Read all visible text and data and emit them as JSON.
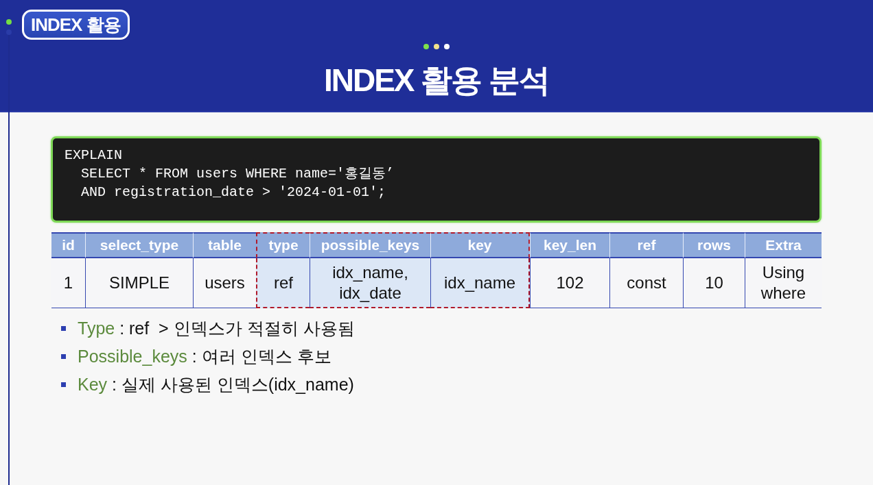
{
  "header": {
    "badge": "INDEX 활용",
    "dots": [
      {
        "color": "#7ee04b"
      },
      {
        "color": "#f2e38c"
      },
      {
        "color": "#ffffff"
      }
    ],
    "title": "INDEX 활용 분석"
  },
  "code": {
    "lines": [
      "EXPLAIN",
      "  SELECT * FROM users WHERE name='홍길동’",
      "  AND registration_date > '2024-01-01';"
    ]
  },
  "table": {
    "columns": [
      {
        "label": "id",
        "highlighted": false
      },
      {
        "label": "select_type",
        "highlighted": false
      },
      {
        "label": "table",
        "highlighted": false
      },
      {
        "label": "type",
        "highlighted": true
      },
      {
        "label": "possible_keys",
        "highlighted": true
      },
      {
        "label": "key",
        "highlighted": true
      },
      {
        "label": "key_len",
        "highlighted": false
      },
      {
        "label": "ref",
        "highlighted": false
      },
      {
        "label": "rows",
        "highlighted": false
      },
      {
        "label": "Extra",
        "highlighted": false
      }
    ],
    "rows": [
      [
        "1",
        "SIMPLE",
        "users",
        "ref",
        "idx_name, idx_date",
        "idx_name",
        "102",
        "const",
        "10",
        "Using where"
      ]
    ]
  },
  "notes": [
    {
      "term": "Type",
      "text": " : ref  > 인덱스가 적절히 사용됨"
    },
    {
      "term": "Possible_keys",
      "text": " : 여러 인덱스 후보"
    },
    {
      "term": "Key",
      "text": " : 실제 사용된 인덱스(idx_name)"
    }
  ]
}
